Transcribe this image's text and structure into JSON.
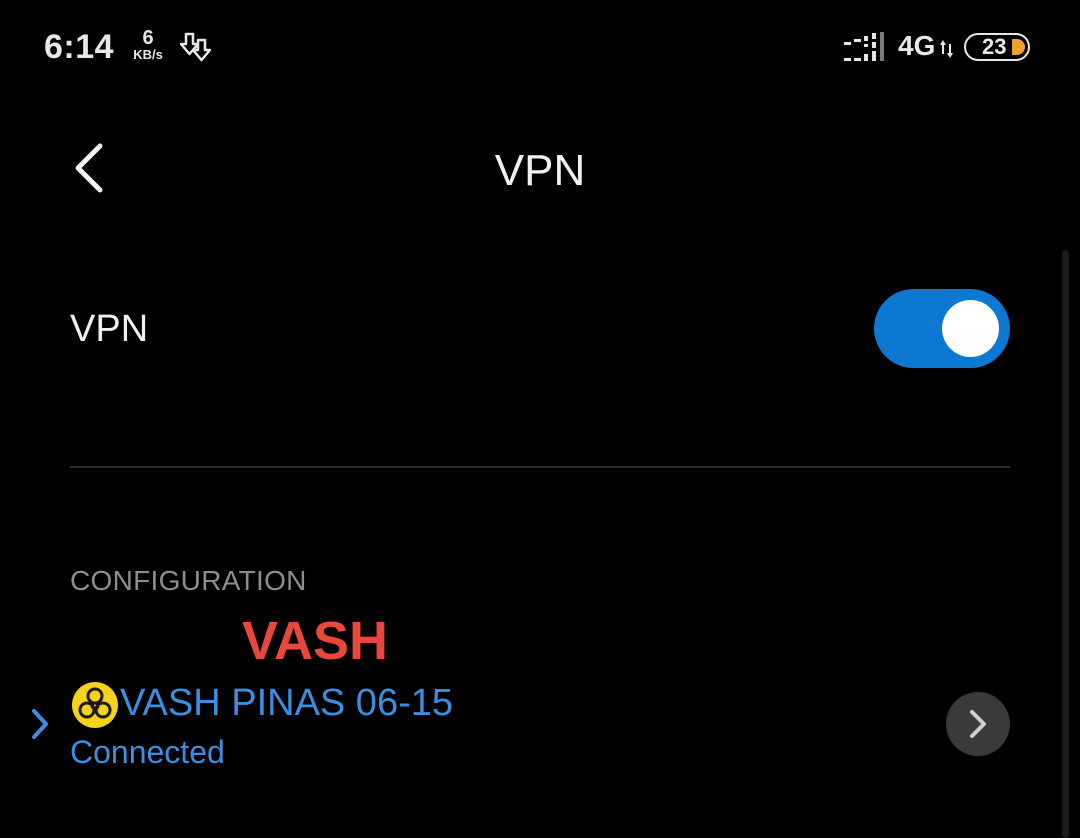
{
  "status_bar": {
    "time": "6:14",
    "speed_value": "6",
    "speed_unit": "KB/s",
    "network": "4G",
    "battery": "23",
    "download_icon": "download-arrows-icon",
    "signal_icon": "signal-bars-icon"
  },
  "header": {
    "title": "VPN",
    "back_icon": "back-arrow-icon"
  },
  "vpn_toggle": {
    "label": "VPN",
    "enabled": true,
    "color": "#0c78d2"
  },
  "configuration": {
    "header": "CONFIGURATION",
    "banner": "VASH",
    "banner_color": "#e8473c",
    "profile": {
      "icon": "biohazard-icon",
      "name": "VASH PINAS 06-15",
      "status": "Connected",
      "color": "#3b8ee0"
    }
  }
}
